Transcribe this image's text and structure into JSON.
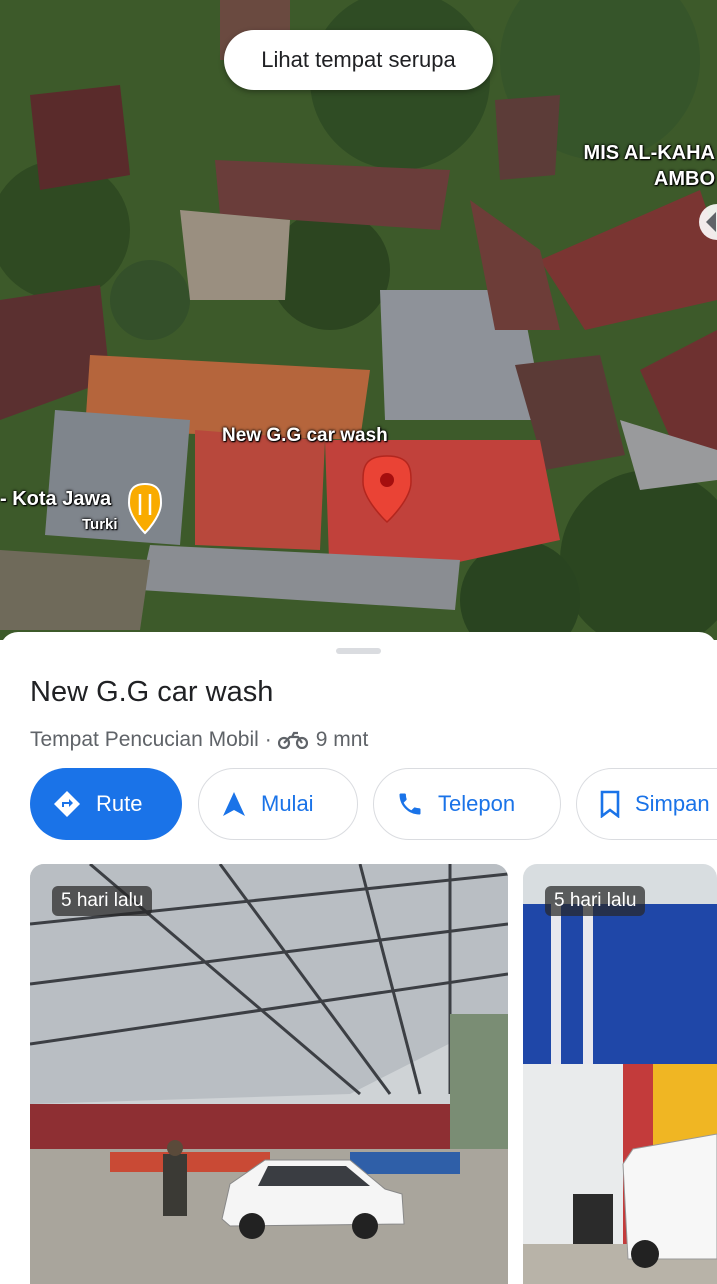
{
  "map": {
    "similar_places_label": "Lihat tempat serupa",
    "labels": {
      "school": "MIS AL-KAHA",
      "school_line2": "AMBO",
      "place_pin": "New G.G car wash",
      "restaurant": "- Kota Jawa",
      "restaurant_sub": "Turki"
    },
    "icons": [
      "red-place-pin-icon",
      "restaurant-fork-knife-icon",
      "location-marker-icon"
    ]
  },
  "place": {
    "name": "New G.G car wash",
    "category": "Tempat Pencucian Mobil",
    "separator": "·",
    "travel_time": "9 mnt",
    "travel_mode_icon": "motorcycle-icon"
  },
  "actions": {
    "route": "Rute",
    "start": "Mulai",
    "phone": "Telepon",
    "save": "Simpan"
  },
  "photos": [
    {
      "age": "5 hari lalu"
    },
    {
      "age": "5 hari lalu"
    }
  ],
  "colors": {
    "accent": "#1a73e8",
    "pin": "#ea4335",
    "restaurant_pin": "#f9ab00"
  }
}
